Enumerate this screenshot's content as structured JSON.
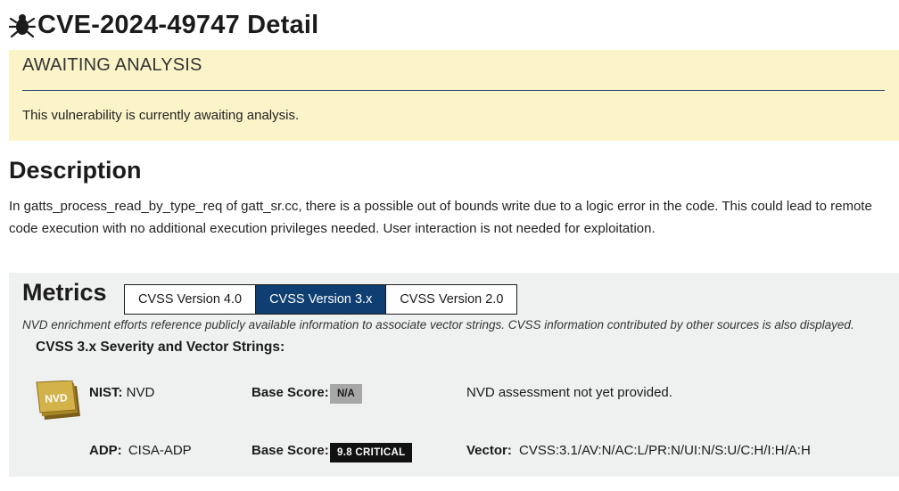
{
  "title": "CVE-2024-49747 Detail",
  "alert": {
    "heading": "AWAITING ANALYSIS",
    "message": "This vulnerability is currently awaiting analysis."
  },
  "description": {
    "heading": "Description",
    "text": "In gatts_process_read_by_type_req of gatt_sr.cc, there is a possible out of bounds write due to a logic error in the code. This could lead to remote code execution with no additional execution privileges needed. User interaction is not needed for exploitation."
  },
  "metrics": {
    "heading": "Metrics",
    "tabs": [
      {
        "label": "CVSS Version 4.0",
        "active": false
      },
      {
        "label": "CVSS Version 3.x",
        "active": true
      },
      {
        "label": "CVSS Version 2.0",
        "active": false
      }
    ],
    "note": "NVD enrichment efforts reference publicly available information to associate vector strings. CVSS information contributed by other sources is also displayed.",
    "severity_heading": "CVSS 3.x Severity and Vector Strings:",
    "nvd_badge_text": "NVD",
    "rows": [
      {
        "source_label": "NIST:",
        "source_value": "NVD",
        "base_score_label": "Base Score:",
        "badge": "N/A",
        "info": "NVD assessment not yet provided."
      },
      {
        "source_label": "ADP:",
        "source_value": "CISA-ADP",
        "base_score_label": "Base Score:",
        "badge": "9.8 CRITICAL",
        "vector_label": "Vector:",
        "vector_value": "CVSS:3.1/AV:N/AC:L/PR:N/UI:N/S:U/C:H/I:H/A:H"
      }
    ]
  },
  "colors": {
    "alert_bg": "#fcf4c9",
    "tab_active": "#0e3e72",
    "metrics_bg": "#eff1f0",
    "badge_na": "#a7a7a7",
    "badge_critical": "#111111",
    "nvd_gold": "#c9a43a"
  },
  "icons": {
    "title": "bug-icon",
    "nvd": "nvd-logo-badge"
  }
}
